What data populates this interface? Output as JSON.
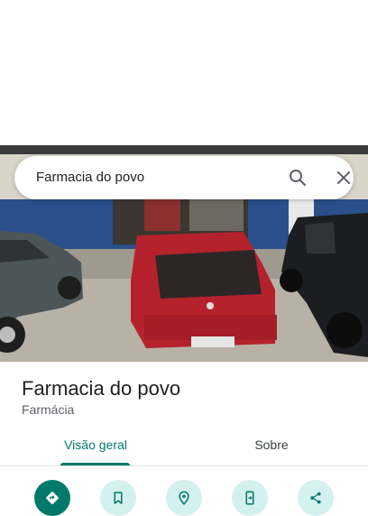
{
  "search": {
    "query": "Farmacia do povo"
  },
  "place": {
    "name": "Farmacia do povo",
    "category": "Farmácia"
  },
  "tabs": [
    {
      "label": "Visão geral",
      "active": true
    },
    {
      "label": "Sobre",
      "active": false
    }
  ],
  "actions": [
    {
      "icon": "directions-icon"
    },
    {
      "icon": "save-bookmark-icon"
    },
    {
      "icon": "nearby-icon"
    },
    {
      "icon": "send-to-phone-icon"
    },
    {
      "icon": "share-icon"
    }
  ],
  "colors": {
    "accent": "#00796b",
    "action_bg": "#d4f0ef"
  }
}
